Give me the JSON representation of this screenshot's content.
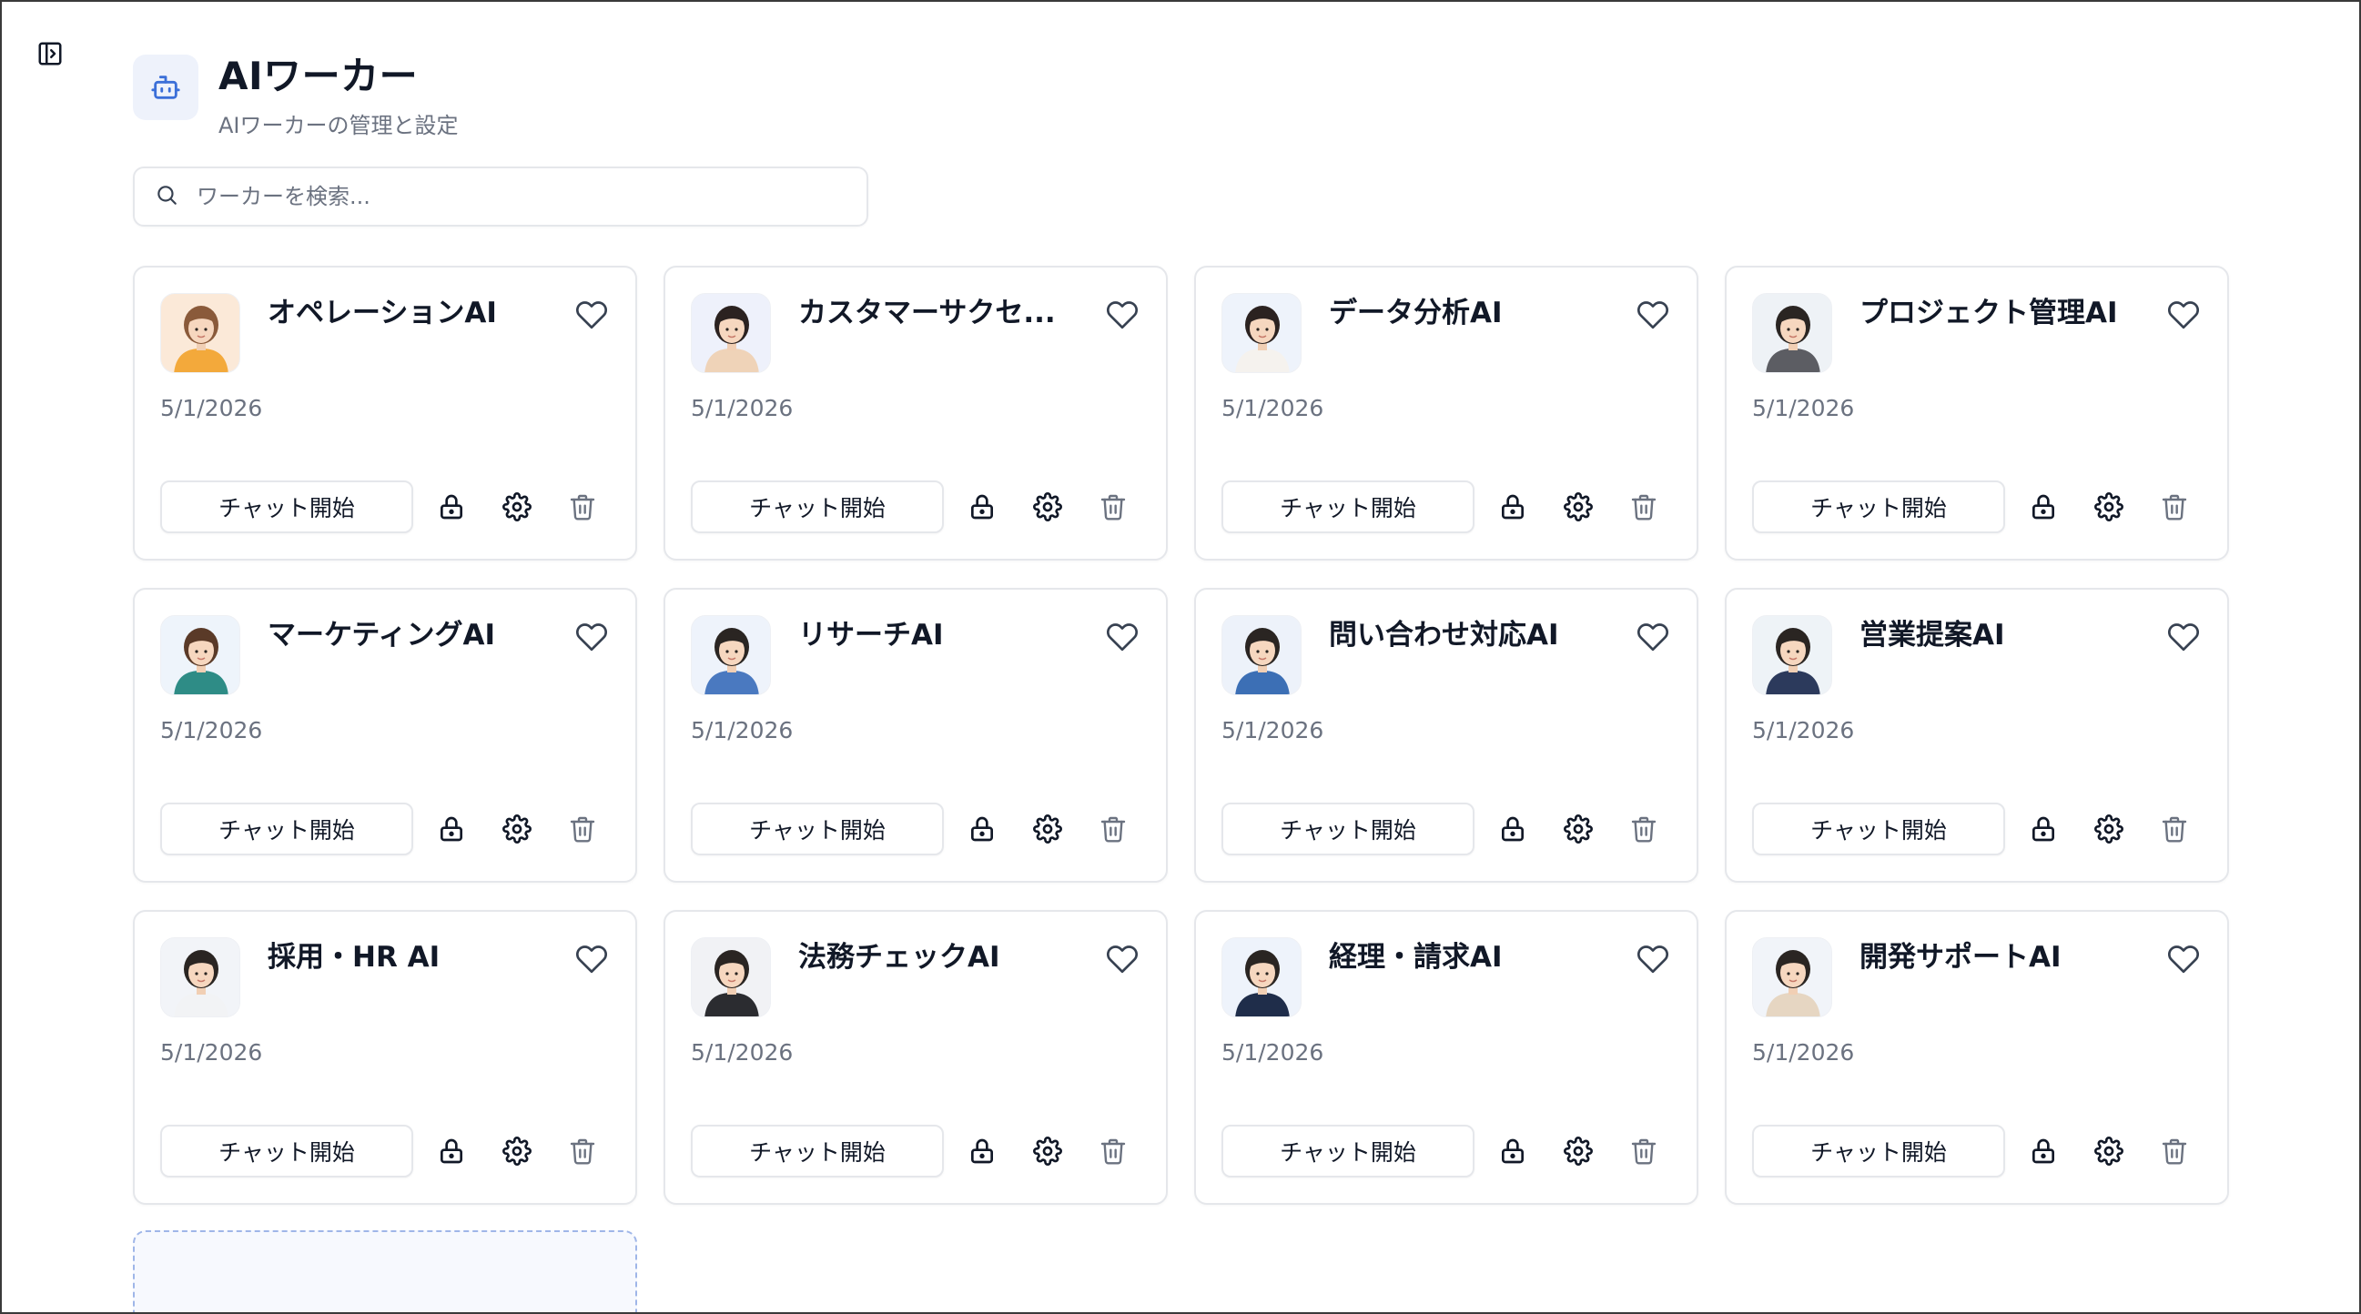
{
  "header": {
    "title": "AIワーカー",
    "subtitle": "AIワーカーの管理と設定"
  },
  "search": {
    "placeholder": "ワーカーを検索..."
  },
  "workers": [
    {
      "name": "オペレーションAI",
      "date": "5/1/2026",
      "chat_label": "チャット開始",
      "avatar": {
        "hair": "#8a5a3a",
        "shirt": "#f3a93b",
        "bg": "#fbe9d8"
      }
    },
    {
      "name": "カスタマーサクセ...",
      "date": "5/1/2026",
      "chat_label": "チャット開始",
      "avatar": {
        "hair": "#2b2220",
        "shirt": "#efd3b8",
        "bg": "#eef1fb"
      }
    },
    {
      "name": "データ分析AI",
      "date": "5/1/2026",
      "chat_label": "チャット開始",
      "avatar": {
        "hair": "#2b2220",
        "shirt": "#f5f2ee",
        "bg": "#eef3fb"
      }
    },
    {
      "name": "プロジェクト管理AI",
      "date": "5/1/2026",
      "chat_label": "チャット開始",
      "avatar": {
        "hair": "#2a2522",
        "shirt": "#5c5d63",
        "bg": "#eef2f6"
      }
    },
    {
      "name": "マーケティングAI",
      "date": "5/1/2026",
      "chat_label": "チャット開始",
      "avatar": {
        "hair": "#5a3a28",
        "shirt": "#2e8c86",
        "bg": "#eef4fb"
      }
    },
    {
      "name": "リサーチAI",
      "date": "5/1/2026",
      "chat_label": "チャット開始",
      "avatar": {
        "hair": "#2a2522",
        "shirt": "#4a79c0",
        "bg": "#eef3fb"
      }
    },
    {
      "name": "問い合わせ対応AI",
      "date": "5/1/2026",
      "chat_label": "チャット開始",
      "avatar": {
        "hair": "#2a2522",
        "shirt": "#3c6fb5",
        "bg": "#edf2fa"
      }
    },
    {
      "name": "営業提案AI",
      "date": "5/1/2026",
      "chat_label": "チャット開始",
      "avatar": {
        "hair": "#2a2522",
        "shirt": "#2c3a5c",
        "bg": "#eef3f7"
      }
    },
    {
      "name": "採用・HR AI",
      "date": "5/1/2026",
      "chat_label": "チャット開始",
      "avatar": {
        "hair": "#2a2522",
        "shirt": "#f2f3f5",
        "bg": "#f2f4f8"
      }
    },
    {
      "name": "法務チェックAI",
      "date": "5/1/2026",
      "chat_label": "チャット開始",
      "avatar": {
        "hair": "#2a2522",
        "shirt": "#2b2c30",
        "bg": "#f1f2f5"
      }
    },
    {
      "name": "経理・請求AI",
      "date": "5/1/2026",
      "chat_label": "チャット開始",
      "avatar": {
        "hair": "#2a2522",
        "shirt": "#1f2d4a",
        "bg": "#eef3fb"
      }
    },
    {
      "name": "開発サポートAI",
      "date": "5/1/2026",
      "chat_label": "チャット開始",
      "avatar": {
        "hair": "#2a2522",
        "shirt": "#e6d6c2",
        "bg": "#f1f4f9"
      }
    }
  ],
  "colors": {
    "accent": "#3b6fd8",
    "icon_bg": "#eef2fb",
    "muted_text": "#6b7280",
    "border": "#e5e7eb",
    "add_card_bg": "#f7f9fe",
    "add_card_border": "#9fb6e8"
  },
  "icons": {
    "sidebar_toggle": "panel-right-open-icon",
    "header": "bot-icon",
    "search": "search-icon",
    "favorite": "heart-icon",
    "lock": "lock-icon",
    "settings": "gear-icon",
    "delete": "trash-icon"
  }
}
